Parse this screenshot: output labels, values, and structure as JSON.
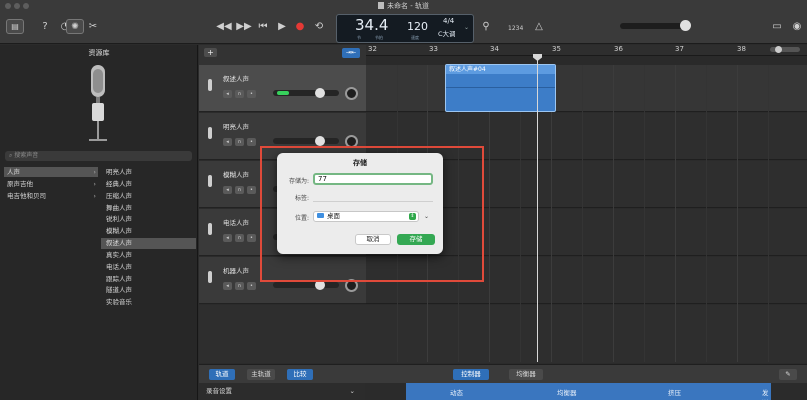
{
  "window": {
    "title": "未命名 - 轨道"
  },
  "lcd": {
    "bar": "34.4",
    "bar_label": "节",
    "beat_label": "节拍",
    "tempo": "120",
    "tempo_label": "速度",
    "signature": "4/4",
    "key": "C大调"
  },
  "toolbar": {
    "count_in": "1234"
  },
  "library": {
    "title": "资源库",
    "search_placeholder": "搜索声音",
    "categories": [
      {
        "label": "人声",
        "selected": true
      },
      {
        "label": "原声吉他",
        "selected": false
      },
      {
        "label": "电吉他和贝司",
        "selected": false
      }
    ],
    "items": [
      {
        "label": "明亮人声",
        "selected": false
      },
      {
        "label": "经典人声",
        "selected": false
      },
      {
        "label": "压缩人声",
        "selected": false
      },
      {
        "label": "舞曲人声",
        "selected": false
      },
      {
        "label": "锐利人声",
        "selected": false
      },
      {
        "label": "模糊人声",
        "selected": false
      },
      {
        "label": "叙述人声",
        "selected": true
      },
      {
        "label": "真实人声",
        "selected": false
      },
      {
        "label": "电话人声",
        "selected": false
      },
      {
        "label": "跟踪人声",
        "selected": false
      },
      {
        "label": "隧道人声",
        "selected": false
      },
      {
        "label": "实验音乐",
        "selected": false
      }
    ]
  },
  "tracks": [
    {
      "name": "叙述人声",
      "selected": true,
      "volume_level": 0.55
    },
    {
      "name": "明亮人声",
      "selected": false,
      "volume_level": 0.55
    },
    {
      "name": "模糊人声",
      "selected": false,
      "volume_level": 0.55
    },
    {
      "name": "电话人声",
      "selected": false,
      "volume_level": 0.55
    },
    {
      "name": "机器人声",
      "selected": false,
      "volume_level": 0.55
    }
  ],
  "ruler": {
    "bars": [
      "32",
      "33",
      "34",
      "35",
      "36",
      "37",
      "38"
    ]
  },
  "region": {
    "label": "叙述人声#04"
  },
  "bottom_bar": {
    "tracks": "轨道",
    "master": "主轨道",
    "compare": "比较",
    "controls": "控制器",
    "eq": "均衡器"
  },
  "bottom_panel": {
    "recording_settings": "录音设置",
    "tabs": [
      "动态",
      "均衡器",
      "挤压",
      "发送"
    ]
  },
  "dialog": {
    "title": "存储",
    "save_as_label": "存储为:",
    "save_as_value": "77",
    "tags_label": "标签:",
    "location_label": "位置:",
    "location_value": "桌面",
    "cancel": "取消",
    "save": "存储"
  },
  "colors": {
    "accent": "#2f6fb8",
    "region": "#3d7dc8",
    "save_button": "#34a853",
    "highlight_frame": "#e04a3a",
    "volume_fill": "#37d15c"
  }
}
